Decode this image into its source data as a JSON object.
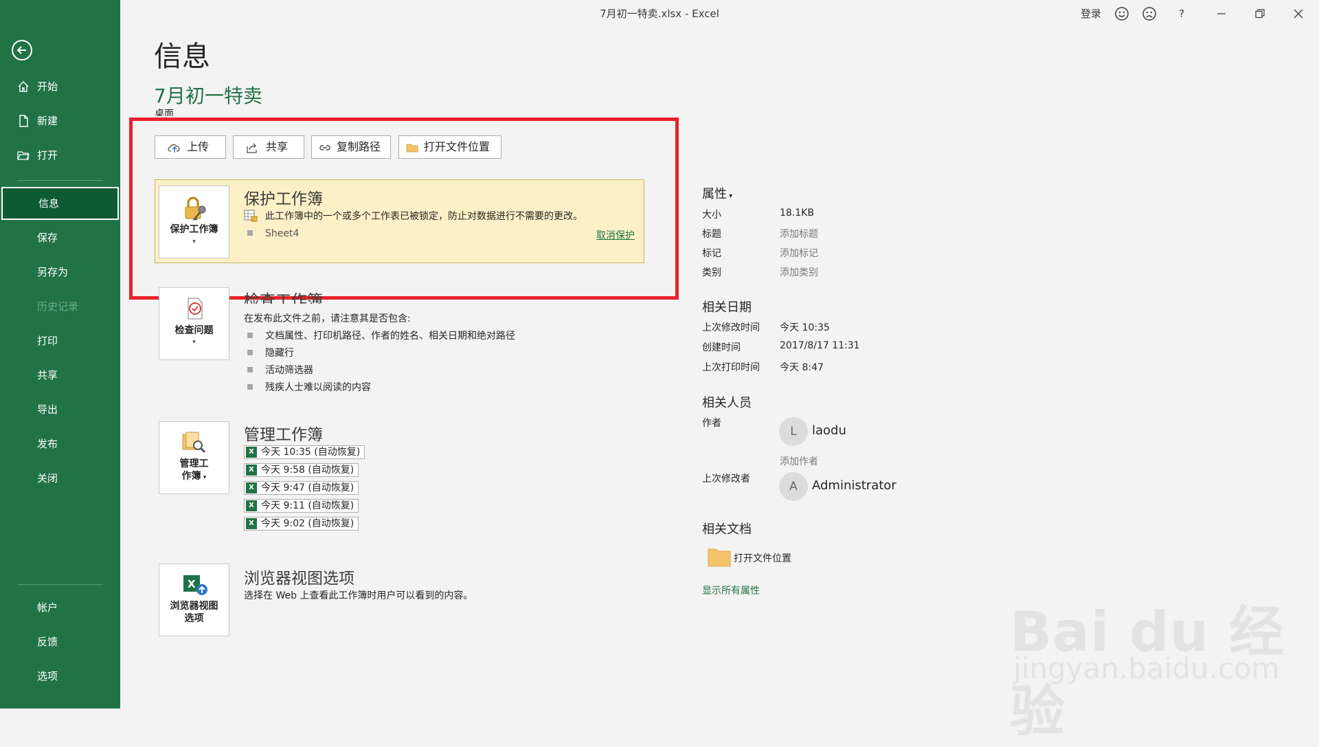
{
  "titlebar": {
    "title": "7月初一特卖.xlsx  -  Excel",
    "signin": "登录",
    "help": "?"
  },
  "sidebar": {
    "items": [
      {
        "label": "开始",
        "icon": "home-icon"
      },
      {
        "label": "新建",
        "icon": "new-doc-icon"
      },
      {
        "label": "打开",
        "icon": "open-folder-icon"
      },
      {
        "label": "信息"
      },
      {
        "label": "保存"
      },
      {
        "label": "另存为"
      },
      {
        "label": "历史记录"
      },
      {
        "label": "打印"
      },
      {
        "label": "共享"
      },
      {
        "label": "导出"
      },
      {
        "label": "发布"
      },
      {
        "label": "关闭"
      },
      {
        "label": "帐户"
      },
      {
        "label": "反馈"
      },
      {
        "label": "选项"
      }
    ]
  },
  "main": {
    "page_title": "信息",
    "doc_name": "7月初一特卖",
    "doc_location": "桌面",
    "actions": {
      "upload": "上传",
      "share": "共享",
      "copy_path": "复制路径",
      "open_location": "打开文件位置"
    },
    "protect": {
      "tile_label": "保护工作簿",
      "title": "保护工作簿",
      "desc": "此工作簿中的一个或多个工作表已被锁定，防止对数据进行不需要的更改。",
      "sheet": "Sheet4",
      "unprotect": "取消保护"
    },
    "inspect": {
      "tile_label": "检查问题",
      "title": "检查工作簿",
      "desc": "在发布此文件之前，请注意其是否包含:",
      "bullets": [
        "文档属性、打印机路径、作者的姓名、相关日期和绝对路径",
        "隐藏行",
        "活动筛选器",
        "残疾人士难以阅读的内容"
      ]
    },
    "manage": {
      "tile_label_1": "管理工",
      "tile_label_2": "作簿",
      "title": "管理工作簿",
      "versions": [
        "今天 10:35 (自动恢复)",
        "今天 9:58 (自动恢复)",
        "今天 9:47 (自动恢复)",
        "今天 9:11 (自动恢复)",
        "今天 9:02 (自动恢复)"
      ]
    },
    "browser": {
      "tile_label_1": "浏览器视图",
      "tile_label_2": "选项",
      "title": "浏览器视图选项",
      "desc": "选择在 Web 上查看此工作簿时用户可以看到的内容。"
    }
  },
  "properties": {
    "heading": "属性",
    "rows": [
      {
        "label": "大小",
        "value": "18.1KB"
      },
      {
        "label": "标题",
        "value": "添加标题"
      },
      {
        "label": "标记",
        "value": "添加标记"
      },
      {
        "label": "类别",
        "value": "添加类别"
      }
    ],
    "dates_heading": "相关日期",
    "dates": [
      {
        "label": "上次修改时间",
        "value": "今天 10:35"
      },
      {
        "label": "创建时间",
        "value": "2017/8/17 11:31"
      },
      {
        "label": "上次打印时间",
        "value": "今天 8:47"
      }
    ],
    "people_heading": "相关人员",
    "author_label": "作者",
    "author_initial": "L",
    "author_name": "laodu",
    "add_author": "添加作者",
    "modifier_label": "上次修改者",
    "modifier_initial": "A",
    "modifier_name": "Administrator",
    "docs_heading": "相关文档",
    "open_location": "打开文件位置",
    "show_all": "显示所有属性"
  },
  "watermark": {
    "main": "Bai du 经验",
    "sub": "jingyan.baidu.com"
  },
  "colors": {
    "sidebar": "#217346",
    "accent": "#217346",
    "highlight_box": "#e8232a",
    "protect_panel": "#fcf0c7"
  }
}
